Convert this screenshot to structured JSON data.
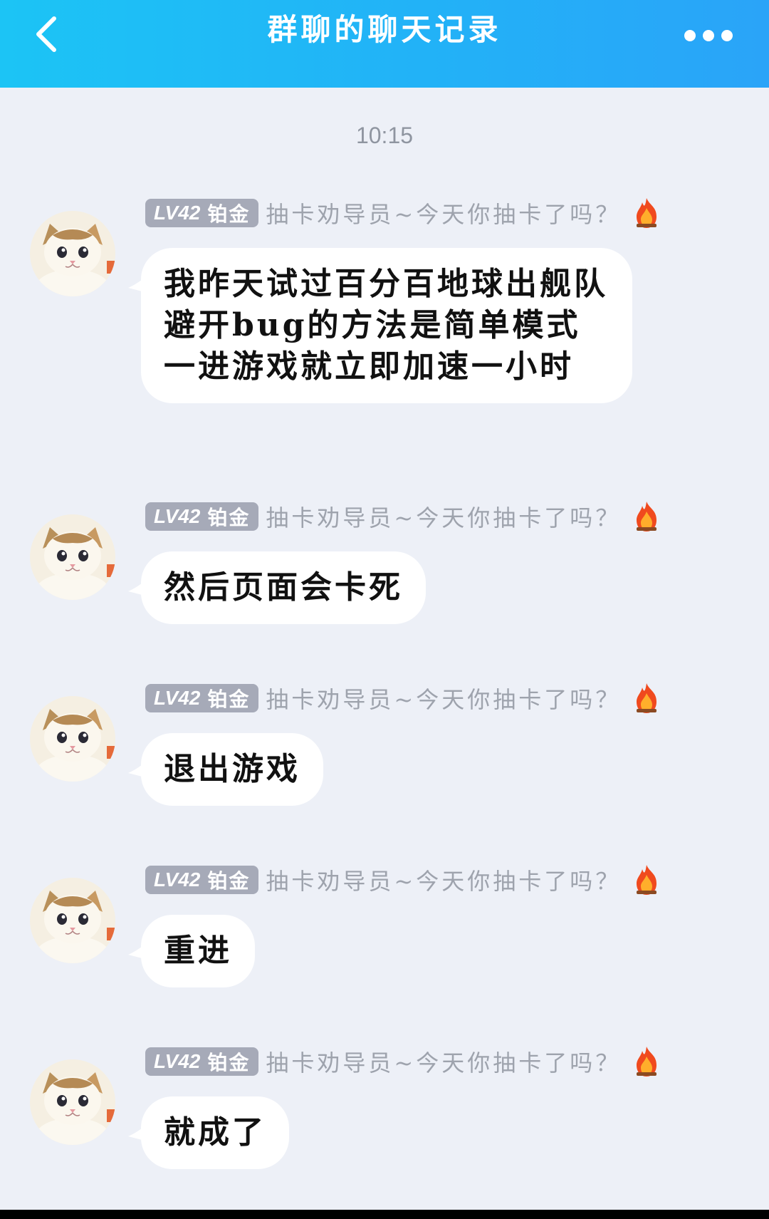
{
  "header": {
    "title": "群聊的聊天记录",
    "back_icon": "chevron-left-icon",
    "more_icon": "more-dots-icon",
    "accent_color": "#22b2f7"
  },
  "timestamp": "10:15",
  "sender": {
    "level": "LV42",
    "rank": "铂金",
    "title": "抽卡劝导员~今天你抽卡了吗？",
    "badge_icon": "fire-icon",
    "avatar": "kitten-avatar"
  },
  "messages": [
    {
      "text": "我昨天试过百分百地球出舰队避开bug的方法是简单模式一进游戏就立即加速一小时"
    },
    {
      "text": "然后页面会卡死"
    },
    {
      "text": "退出游戏"
    },
    {
      "text": "重进"
    },
    {
      "text": "就成了"
    }
  ]
}
